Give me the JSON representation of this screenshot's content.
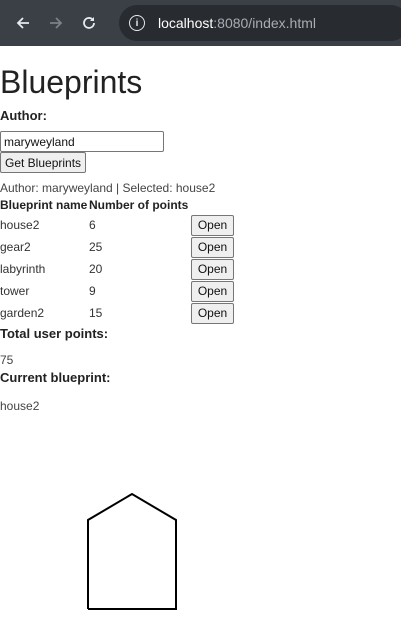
{
  "browser": {
    "url_host": "localhost",
    "url_rest": ":8080/index.html"
  },
  "page": {
    "title": "Blueprints",
    "author_label": "Author:",
    "author_value": "maryweyland",
    "get_button": "Get Blueprints",
    "status": "Author: maryweyland | Selected: house2",
    "table": {
      "headers": [
        "Blueprint name",
        "Number of points"
      ],
      "rows": [
        {
          "name": "house2",
          "points": "6",
          "action": "Open"
        },
        {
          "name": "gear2",
          "points": "25",
          "action": "Open"
        },
        {
          "name": "labyrinth",
          "points": "20",
          "action": "Open"
        },
        {
          "name": "tower",
          "points": "9",
          "action": "Open"
        },
        {
          "name": "garden2",
          "points": "15",
          "action": "Open"
        }
      ]
    },
    "total_label": "Total user points:",
    "total_value": "75",
    "current_label": "Current blueprint:",
    "current_value": "house2"
  }
}
